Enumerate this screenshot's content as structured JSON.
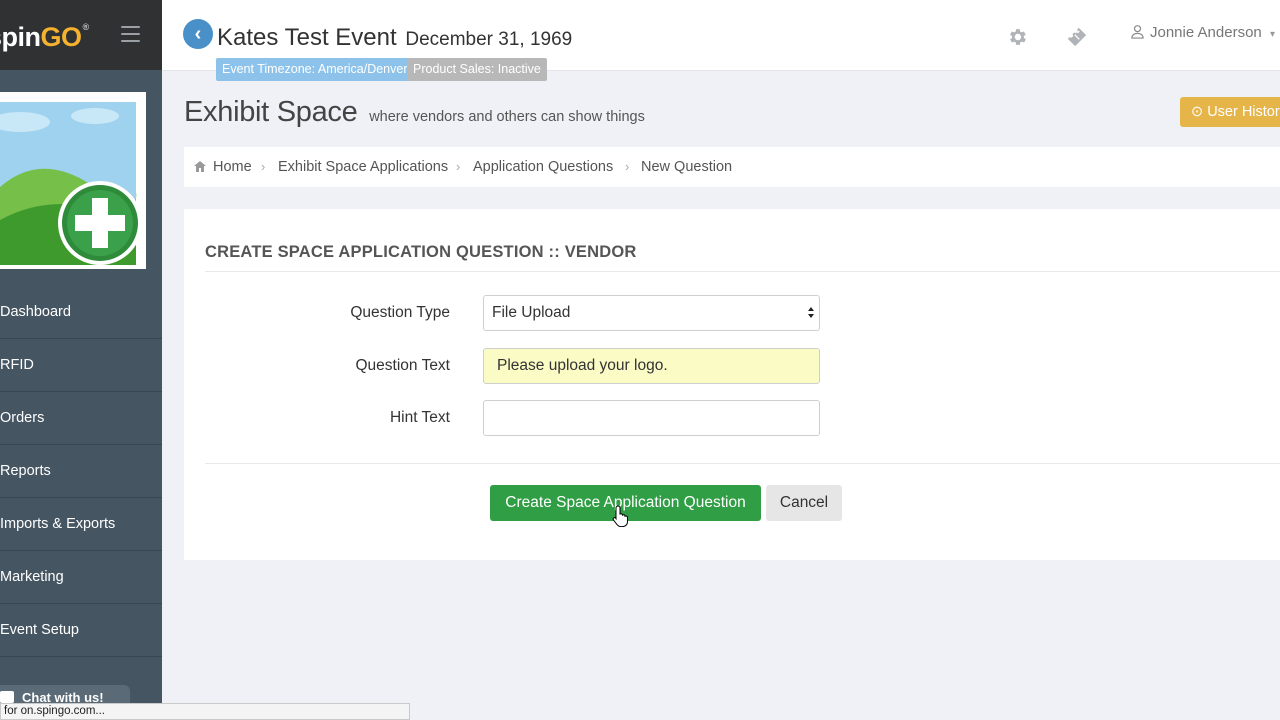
{
  "app": {
    "logo_main": "pin",
    "logo_prefix": "s",
    "logo_accent": "GO",
    "logo_reg": "®",
    "colors": {
      "sidebar": "#455562",
      "brand_bar": "#2f3133",
      "accent_green": "#2f9e44",
      "accent_yellow": "#e6b54a",
      "back_blue": "#4a90c8"
    }
  },
  "sidebar": {
    "items": [
      {
        "label": "Dashboard"
      },
      {
        "label": "RFID"
      },
      {
        "label": "Orders"
      },
      {
        "label": "Reports"
      },
      {
        "label": "Imports & Exports"
      },
      {
        "label": "Marketing"
      },
      {
        "label": "Event Setup"
      }
    ],
    "chat_label": "Chat with us!"
  },
  "status_bar": {
    "url_text": "for on.spingo.com..."
  },
  "header": {
    "event_title": "Kates Test Event",
    "event_date": "December 31, 1969",
    "timezone_badge": "Event Timezone: America/Denver",
    "product_sales_badge": "Product Sales: Inactive",
    "user_name": "Jonnie Anderson",
    "icons": [
      "back-arrow-icon",
      "gear-icon",
      "ticket-icon",
      "user-icon",
      "chevron-down-icon"
    ]
  },
  "page": {
    "title": "Exhibit Space",
    "subtitle": "where vendors and others can show things",
    "history_button": "User History"
  },
  "breadcrumb": {
    "items": [
      {
        "label": "Home"
      },
      {
        "label": "Exhibit Space Applications"
      },
      {
        "label": "Application Questions"
      },
      {
        "label": "New Question"
      }
    ]
  },
  "form": {
    "title": "CREATE SPACE APPLICATION QUESTION :: VENDOR",
    "question_type_label": "Question Type",
    "question_type_value": "File Upload",
    "question_text_label": "Question Text",
    "question_text_value": "Please upload your logo.",
    "hint_text_label": "Hint Text",
    "hint_text_value": "",
    "submit_label": "Create Space Application Question",
    "cancel_label": "Cancel"
  }
}
